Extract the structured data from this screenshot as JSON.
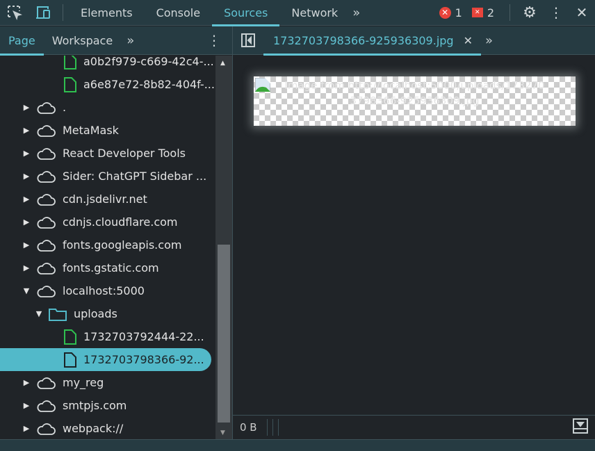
{
  "toolbar": {
    "tabs": [
      "Elements",
      "Console",
      "Sources",
      "Network"
    ],
    "active_tab": "Sources",
    "error_count": "1",
    "issue_count": "2"
  },
  "navigator": {
    "tabs": [
      "Page",
      "Workspace"
    ],
    "active_tab": "Page",
    "items": [
      {
        "label": "a0b2f979-c669-42c4-...",
        "type": "file-green",
        "depth": 2
      },
      {
        "label": "a6e87e72-8b82-404f-...",
        "type": "file-green",
        "depth": 2
      },
      {
        "label": ".",
        "type": "cloud",
        "depth": 0,
        "expanded": false
      },
      {
        "label": "MetaMask",
        "type": "cloud",
        "depth": 0,
        "expanded": false
      },
      {
        "label": "React Developer Tools",
        "type": "cloud",
        "depth": 0,
        "expanded": false
      },
      {
        "label": "Sider: ChatGPT Sidebar ...",
        "type": "cloud",
        "depth": 0,
        "expanded": false
      },
      {
        "label": "cdn.jsdelivr.net",
        "type": "cloud",
        "depth": 0,
        "expanded": false
      },
      {
        "label": "cdnjs.cloudflare.com",
        "type": "cloud",
        "depth": 0,
        "expanded": false
      },
      {
        "label": "fonts.googleapis.com",
        "type": "cloud",
        "depth": 0,
        "expanded": false
      },
      {
        "label": "fonts.gstatic.com",
        "type": "cloud",
        "depth": 0,
        "expanded": false
      },
      {
        "label": "localhost:5000",
        "type": "cloud",
        "depth": 0,
        "expanded": true
      },
      {
        "label": "uploads",
        "type": "folder",
        "depth": 1,
        "expanded": true
      },
      {
        "label": "1732703792444-22...",
        "type": "file-green",
        "depth": 2
      },
      {
        "label": "1732703798366-92...",
        "type": "file",
        "depth": 2,
        "selected": true
      },
      {
        "label": "my_reg",
        "type": "cloud",
        "depth": 0,
        "expanded": false
      },
      {
        "label": "smtpjs.com",
        "type": "cloud",
        "depth": 0,
        "expanded": false
      },
      {
        "label": "webpack://",
        "type": "cloud",
        "depth": 0,
        "expanded": false
      }
    ]
  },
  "editor": {
    "tab_label": "1732703798366-925936309.jpg",
    "image_alt": "Image from http://localhost:5000/uploads/1732703798366-925936309.jpg"
  },
  "status": {
    "size": "0 B"
  },
  "colors": {
    "accent": "#61c3d3",
    "header": "#263b42",
    "panel": "#202428",
    "error": "#e8453c",
    "file_green": "#2fbf4f"
  }
}
